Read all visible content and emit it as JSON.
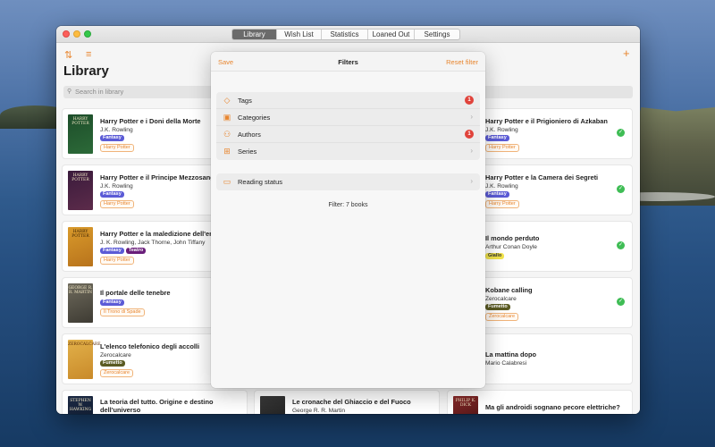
{
  "tabs": [
    "Library",
    "Wish List",
    "Statistics",
    "Loaned Out",
    "Settings"
  ],
  "header": {
    "title": "Library",
    "search_placeholder": "Search in library"
  },
  "popover": {
    "save": "Save",
    "title": "Filters",
    "reset": "Reset filter",
    "rows": [
      {
        "label": "Tags",
        "badge": "1"
      },
      {
        "label": "Categories"
      },
      {
        "label": "Authors",
        "badge": "1"
      },
      {
        "label": "Series"
      }
    ],
    "reading_status": "Reading status",
    "count": "Filter: 7 books"
  },
  "books_left": [
    {
      "title": "Harry Potter e i Doni della Morte",
      "author": "J.K. Rowling",
      "tags": [
        "Fantasy"
      ],
      "series": "Harry Potter",
      "cover": "HARRY POTTER"
    },
    {
      "title": "Harry Potter e il Principe Mezzosangue",
      "author": "J.K. Rowling, Jack Thorne, John Tiffany",
      "tags": [
        "Fantasy"
      ],
      "series": "Harry Potter",
      "cover": "HARRY POTTER"
    },
    {
      "title": "Harry Potter e la maledizione dell'erede",
      "author": "J. K. Rowling, Jack Thorne, John Tiffany",
      "tags": [
        "Fantasy",
        "Teatro"
      ],
      "series": "Harry Potter",
      "cover": "HARRY POTTER"
    },
    {
      "title": "Il portale delle tenebre",
      "author": "",
      "tags": [
        "Fantasy"
      ],
      "series": "Il Trono di Spade",
      "cover": "GEORGE R. R. MARTIN"
    },
    {
      "title": "L'elenco telefonico degli accolli",
      "author": "Zerocalcare",
      "tags": [
        "Fumetto"
      ],
      "series": "Zerocalcare",
      "cover": "ZEROCALCARE"
    },
    {
      "title": "La teoria del tutto. Origine e destino dell'universo",
      "author": "",
      "tags": [],
      "series": "",
      "cover": "STEPHEN W. HAWKING"
    }
  ],
  "book_middle_bottom": {
    "title": "Le cronache del Ghiaccio e del Fuoco",
    "author": "George R. R. Martin"
  },
  "books_right": [
    {
      "title": "Harry Potter e il Prigioniero di Azkaban",
      "author": "J.K. Rowling",
      "tags": [
        "Fantasy"
      ],
      "series": "Harry Potter",
      "check": "✓"
    },
    {
      "title": "Harry Potter e la Camera dei Segreti",
      "author": "J.K. Rowling",
      "tags": [
        "Fantasy"
      ],
      "series": "Harry Potter",
      "check": "✓"
    },
    {
      "title": "Il mondo perduto",
      "author": "Arthur Conan Doyle",
      "tags": [
        "Giallo"
      ],
      "series": "",
      "check": "✓"
    },
    {
      "title": "Kobane calling",
      "author": "Zerocalcare",
      "tags": [
        "Fumetto"
      ],
      "series": "Zerocalcare",
      "check": "✓"
    },
    {
      "title": "La mattina dopo",
      "author": "Mario Calabresi",
      "tags": [],
      "series": ""
    },
    {
      "title": "Ma gli androidi sognano pecore elettriche?",
      "author": "",
      "tags": [],
      "series": "",
      "cover": "PHILIP K. DICK"
    }
  ],
  "colors": {
    "accent": "#e8862f",
    "fantasy": "#5b5bd6",
    "teatro": "#6a1e7a",
    "fumetto": "#5a5a22",
    "giallo": "#f2e44b",
    "check": "#3fbd55",
    "badge": "#e0433b"
  },
  "icons": {
    "sort": "sort-arrows-icon",
    "filter": "filter-lines-icon",
    "add": "plus-icon",
    "tag": "tag-icon",
    "categories": "box-icon",
    "authors": "people-icon",
    "series": "grid-icon",
    "reading": "book-icon",
    "chevron": "chevron-right-icon"
  }
}
